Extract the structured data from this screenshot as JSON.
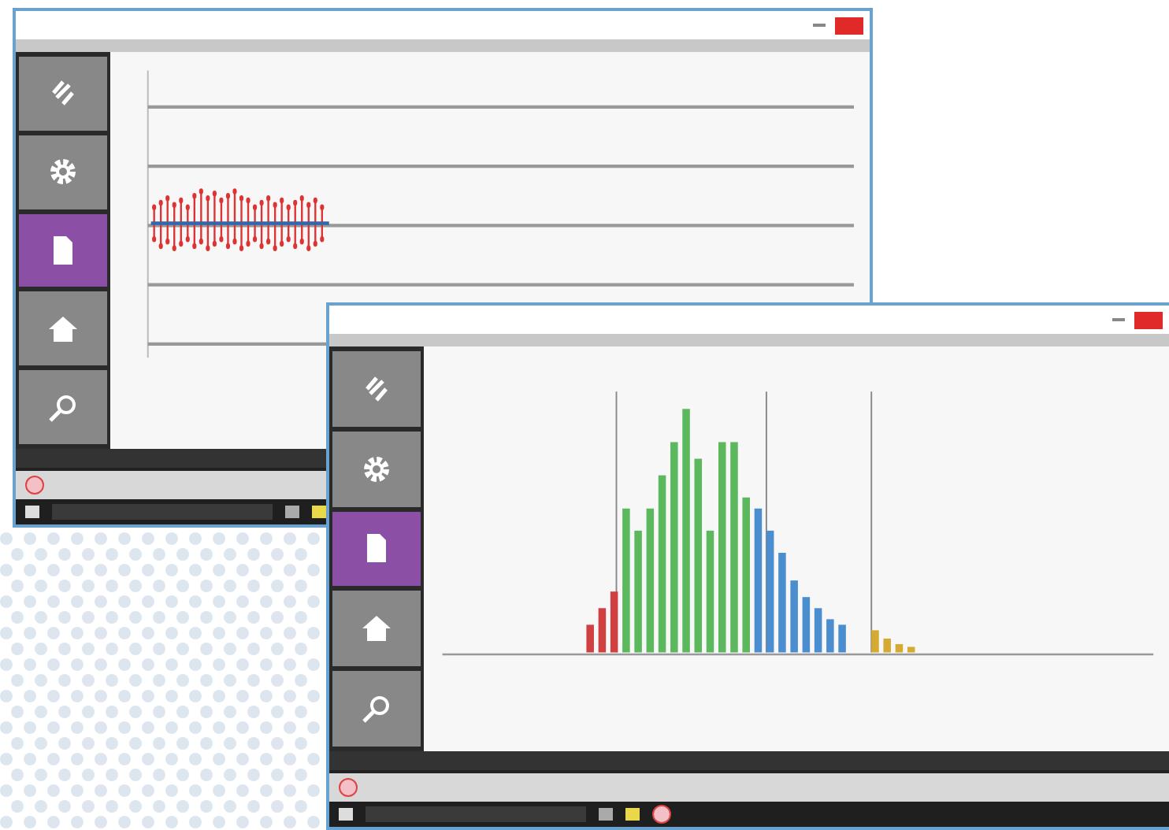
{
  "windows": [
    {
      "kind": "scatter",
      "close_highlighted": true,
      "sidebar": [
        {
          "selected": false
        },
        {
          "selected": false
        },
        {
          "selected": true
        },
        {
          "selected": false
        },
        {
          "selected": false
        }
      ]
    },
    {
      "kind": "histogram",
      "close_highlighted": true,
      "sidebar": [
        {
          "selected": false
        },
        {
          "selected": false
        },
        {
          "selected": true
        },
        {
          "selected": false
        },
        {
          "selected": false
        }
      ]
    }
  ]
}
